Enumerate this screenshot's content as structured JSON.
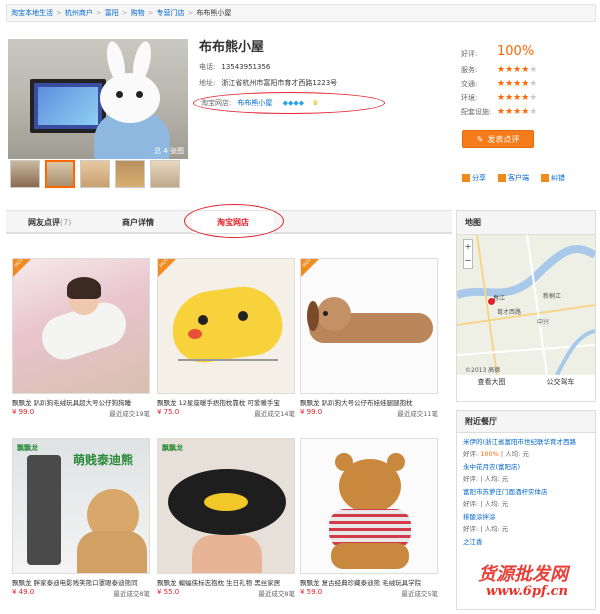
{
  "breadcrumb": [
    "淘宝本地生活",
    "杭州商户",
    "富阳",
    "购物",
    "专营门店",
    "布布熊小屋"
  ],
  "shop": {
    "name": "布布熊小屋",
    "phone_label": "电话:",
    "phone": "13543951356",
    "address_label": "地址:",
    "address": "浙江省杭州市富阳市育才西路1223号",
    "taobao_label": "淘宝网店:",
    "taobao_link": "布布熊小屋",
    "photo_count": "总 4 张图"
  },
  "ratings": {
    "good_label": "好评:",
    "good_value": "100%",
    "items": [
      {
        "label": "服务:",
        "stars": 4
      },
      {
        "label": "交通:",
        "stars": 4
      },
      {
        "label": "环境:",
        "stars": 4
      },
      {
        "label": "配套设施:",
        "stars": 4
      }
    ]
  },
  "review_button": "发表点评",
  "actions": [
    "分享",
    "客户端",
    "纠错"
  ],
  "tabs": [
    {
      "label": "网友点评",
      "count": "(7)"
    },
    {
      "label": "商户详情",
      "count": ""
    },
    {
      "label": "淘宝网店",
      "count": ""
    }
  ],
  "products": [
    {
      "title": "飘飘龙 趴趴狗毛绒玩具超大号公仔狗狗睡",
      "price": "¥ 99.0",
      "sold": "最近成交19笔",
      "hot": true
    },
    {
      "title": "飘飘龙 12星座暖手捂抱枕靠枕 可爱暖手宝",
      "price": "¥ 75.0",
      "sold": "最近成交14笔",
      "hot": true
    },
    {
      "title": "飘飘龙 趴趴狗大号公仔布娃娃腿腿抱枕",
      "price": "¥ 99.0",
      "sold": "最近成交11笔",
      "hot": true
    },
    {
      "title": "飘飘龙 胖家泰迪电影贱笑熊口罩眼泰迪熊同",
      "price": "¥ 49.0",
      "sold": "最近成交8笔",
      "hot": false
    },
    {
      "title": "飘飘龙 蝙蝠侠标志抱枕 生日礼物 黑丝家居",
      "price": "¥ 55.0",
      "sold": "最近成交8笔",
      "hot": false
    },
    {
      "title": "飘飘龙 复古经典珍藏泰迪熊 毛绒玩具学院",
      "price": "¥ 59.0",
      "sold": "最近成交5笔",
      "hot": false
    }
  ],
  "map": {
    "title": "地图",
    "labels": [
      "春江",
      "新桐江",
      "中兴",
      "育才西路",
      "富春江",
      "新登乡",
      "公望",
      "东洲"
    ],
    "foot": [
      "查看大图",
      "公交驾车"
    ],
    "copyright": "©2013 高德"
  },
  "nearby": {
    "title": "附近餐厅",
    "items": [
      {
        "name": "米伊的(浙江省富阳市世纪联华育才西路",
        "good": "100%",
        "rest": " | 人均:  元"
      },
      {
        "name": "永中花月农(富阳店)",
        "good": "",
        "rest": "好评:   | 人均:  元"
      },
      {
        "name": "富阳市苏萝庄门面酒杆实体店",
        "good": "",
        "rest": "好评:   | 人均:  元"
      },
      {
        "name": "排酸涂拌涂",
        "good": "",
        "rest": "好评:   | 人均:  元"
      },
      {
        "name": "之江香",
        "good": "",
        "rest": "好评:   | 人均:  元"
      }
    ],
    "good_prefix": "好评: "
  },
  "watermark": {
    "line1": "货源批发网",
    "line2": "www.6pf.cn"
  }
}
